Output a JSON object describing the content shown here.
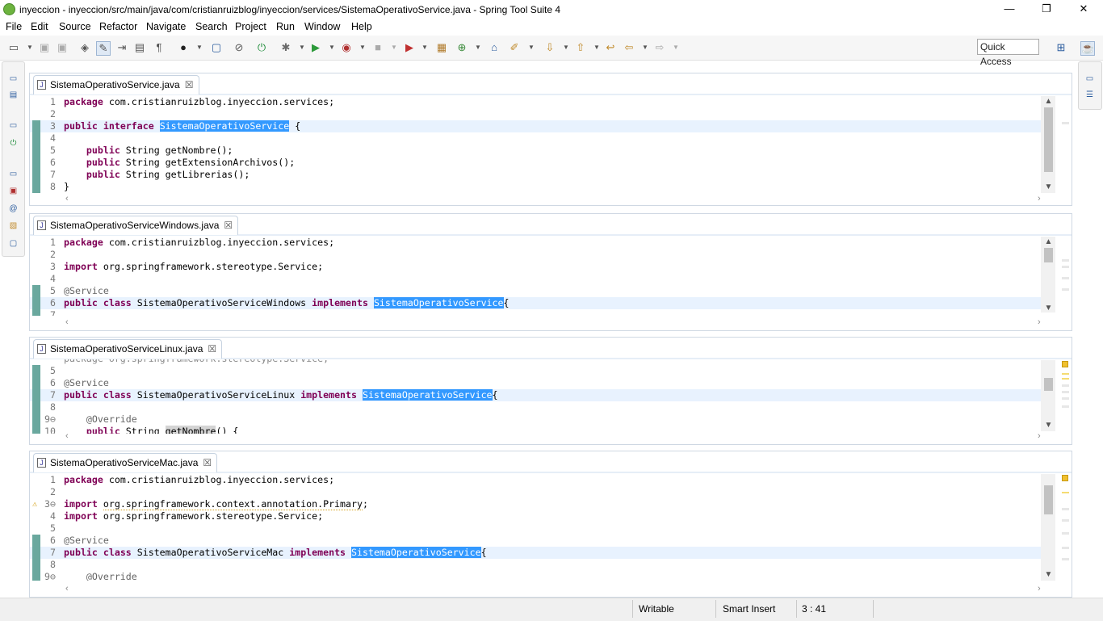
{
  "window": {
    "title": "inyeccion - inyeccion/src/main/java/com/cristianruizblog/inyeccion/services/SistemaOperativoService.java - Spring Tool Suite 4",
    "minimize": "—",
    "restore": "❐",
    "close": "✕"
  },
  "menu": [
    "File",
    "Edit",
    "Source",
    "Refactor",
    "Navigate",
    "Search",
    "Project",
    "Run",
    "Window",
    "Help"
  ],
  "quick_access": "Quick Access",
  "editors": [
    {
      "tab": "SistemaOperativoService.java",
      "lines": [
        {
          "n": "1",
          "t": "package com.cristianruizblog.inyeccion.services;"
        },
        {
          "n": "2",
          "t": ""
        },
        {
          "n": "3",
          "t": "public interface SistemaOperativoService {"
        },
        {
          "n": "4",
          "t": ""
        },
        {
          "n": "5",
          "t": "    public String getNombre();"
        },
        {
          "n": "6",
          "t": "    public String getExtensionArchivos();"
        },
        {
          "n": "7",
          "t": "    public String getLibrerias();"
        },
        {
          "n": "8",
          "t": "}"
        }
      ]
    },
    {
      "tab": "SistemaOperativoServiceWindows.java",
      "lines": [
        {
          "n": "1",
          "t": "package com.cristianruizblog.inyeccion.services;"
        },
        {
          "n": "2",
          "t": ""
        },
        {
          "n": "3",
          "t": "import org.springframework.stereotype.Service;"
        },
        {
          "n": "4",
          "t": ""
        },
        {
          "n": "5",
          "t": "@Service"
        },
        {
          "n": "6",
          "t": "public class SistemaOperativoServiceWindows implements SistemaOperativoService{"
        },
        {
          "n": "7",
          "t": ""
        }
      ]
    },
    {
      "tab": "SistemaOperativoServiceLinux.java",
      "lines": [
        {
          "n": "5",
          "t": ""
        },
        {
          "n": "6",
          "t": "@Service"
        },
        {
          "n": "7",
          "t": "public class SistemaOperativoServiceLinux implements SistemaOperativoService{"
        },
        {
          "n": "8",
          "t": ""
        },
        {
          "n": "9⊖",
          "t": "    @Override"
        },
        {
          "n": "10",
          "t": "    public String getNombre() {"
        }
      ]
    },
    {
      "tab": "SistemaOperativoServiceMac.java",
      "lines": [
        {
          "n": "1",
          "t": "package com.cristianruizblog.inyeccion.services;"
        },
        {
          "n": "2",
          "t": ""
        },
        {
          "n": "3⊖",
          "t": "import org.springframework.context.annotation.Primary;"
        },
        {
          "n": "4",
          "t": "import org.springframework.stereotype.Service;"
        },
        {
          "n": "5",
          "t": ""
        },
        {
          "n": "6",
          "t": "@Service"
        },
        {
          "n": "7",
          "t": "public class SistemaOperativoServiceMac implements SistemaOperativoService{"
        },
        {
          "n": "8",
          "t": ""
        },
        {
          "n": "9⊖",
          "t": "    @Override"
        }
      ]
    }
  ],
  "status": {
    "writable": "Writable",
    "insert_mode": "Smart Insert",
    "position": "3 : 41"
  }
}
